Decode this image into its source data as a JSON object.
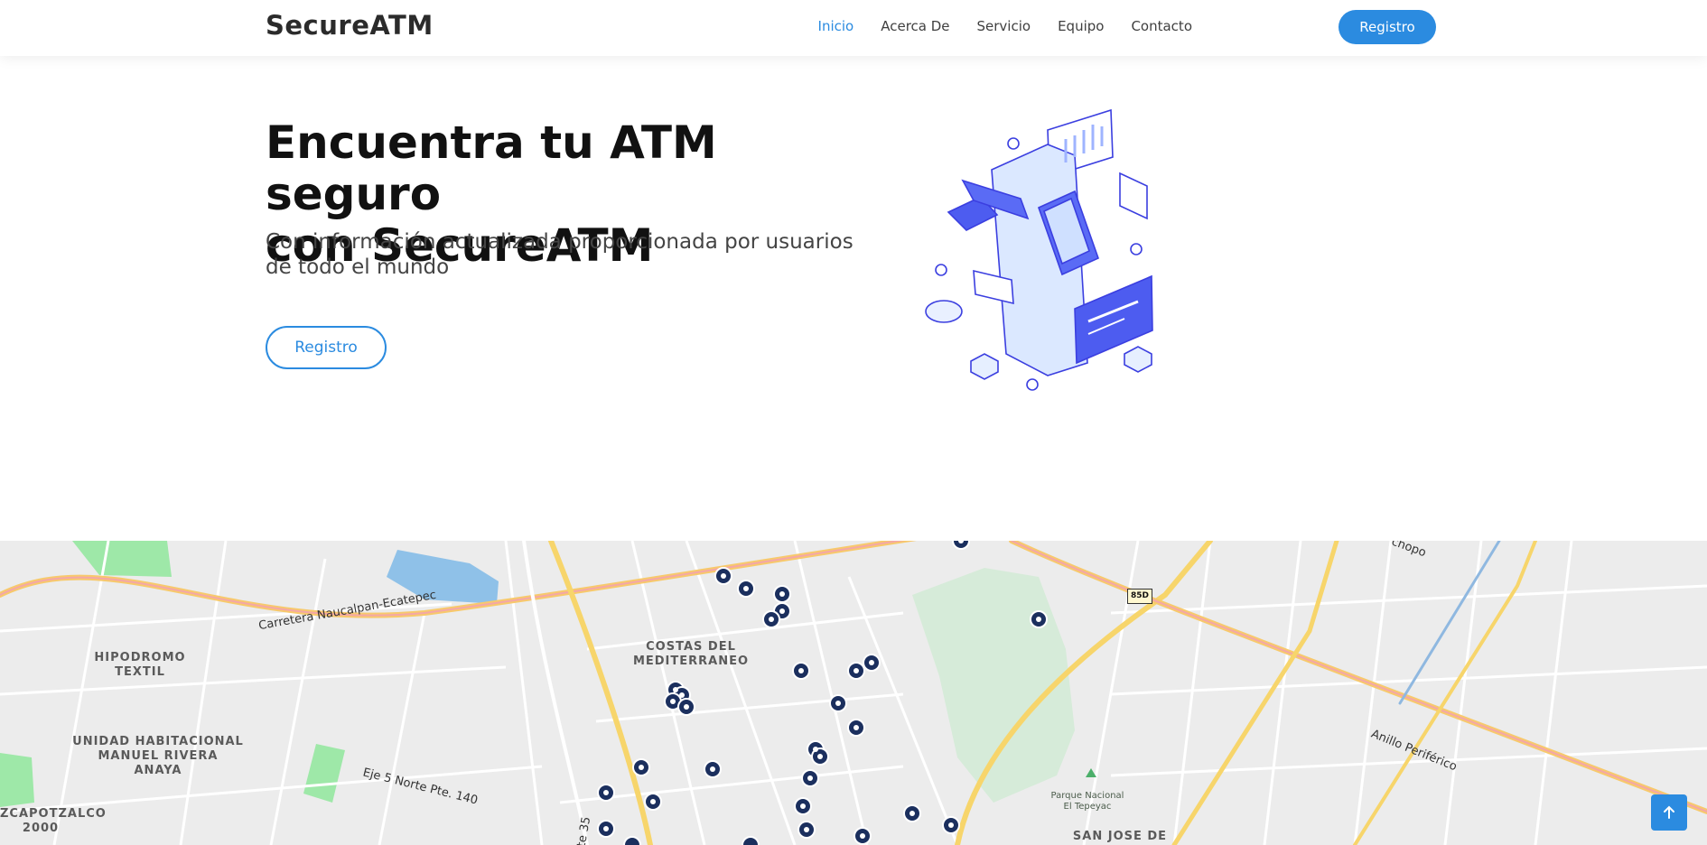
{
  "header": {
    "logo": "SecureATM",
    "nav": [
      "Inicio",
      "Acerca De",
      "Servicio",
      "Equipo",
      "Contacto"
    ],
    "cta": "Registro"
  },
  "hero": {
    "title_line1": "Encuentra tu ATM seguro",
    "title_line2": "con SecureATM",
    "subtitle": "Con información actualizada proporcionada por usuarios de todo el mundo",
    "button": "Registro"
  },
  "map": {
    "areas": [
      "COSTAS DEL MEDITERRANEO",
      "HIPODROMO TEXTIL",
      "UNIDAD HABITACIONAL MANUEL RIVERA ANAYA",
      "ZCAPOTZALCO 2000",
      "SAN JOSE DE"
    ],
    "roads": [
      "Carretera Naucalpan-Ecatepec",
      "Eje 5 Norte Pte. 140",
      "Anillo Periférico",
      "chopo",
      "te 35"
    ],
    "highway_shield": "85D",
    "park": "Parque Nacional El Tepeyac"
  },
  "colors": {
    "accent": "#2b8be0",
    "marker": "#1b2f5e"
  }
}
